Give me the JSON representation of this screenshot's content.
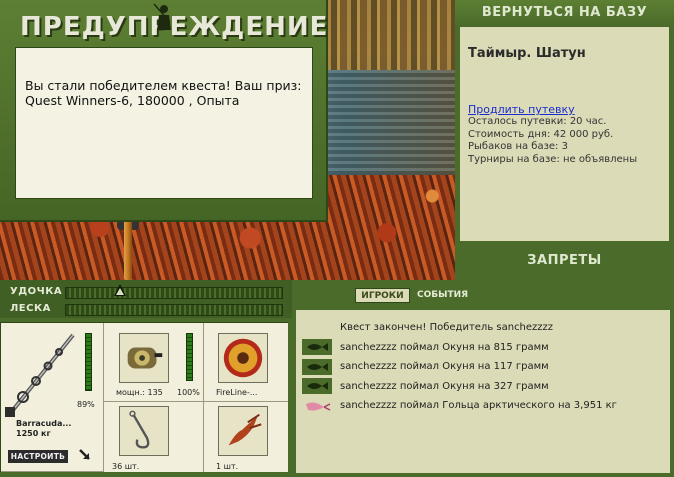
{
  "warning": {
    "title": "ПРЕДУПРЕЖДЕНИЕ",
    "message": "Вы стали победителем квеста! Ваш приз: Quest Winners-6, 180000 , Опыта"
  },
  "base": {
    "return_label": "ВЕРНУТЬСЯ НА БАЗУ",
    "name": "Таймыр. Шатун",
    "extend_label": "Продлить путевку",
    "lines": [
      "Осталось путевки: 20 час.",
      "Стоимость дня: 42 000 руб.",
      "Рыбаков на базе: 3",
      "Турниры на базе: не объявлены"
    ],
    "bans_label": "ЗАПРЕТЫ"
  },
  "tackle": {
    "rod_label": "УДОЧКА",
    "line_label": "ЛЕСКА",
    "rod_tension": 0.25
  },
  "equipment": {
    "rod": {
      "name": "Barracuda...",
      "weight": "1250 кг",
      "condition": "89%",
      "condition_value": 0.89
    },
    "reel": {
      "power": "мощн.: 135",
      "condition": "100%",
      "condition_value": 1.0
    },
    "line": {
      "name": "FireLine-..."
    },
    "hook": {
      "count": "36 шт."
    },
    "bait": {
      "count": "1 шт."
    },
    "tune_label": "НАСТРОИТЬ"
  },
  "events": {
    "tabs": [
      "ИГРОКИ",
      "СОБЫТИЯ"
    ],
    "items": [
      {
        "icon": "none",
        "text": "Квест закончен! Победитель sanchezzzz"
      },
      {
        "icon": "fish-icon",
        "text": "sanchezzzz поймал Окуня на 815 грамм"
      },
      {
        "icon": "fish-icon",
        "text": "sanchezzzz поймал Окуня на 117 грамм"
      },
      {
        "icon": "fish-icon",
        "text": "sanchezzzz поймал Окуня на 327 грамм"
      },
      {
        "icon": "lure-icon",
        "text": "sanchezzzz поймал Гольца арктического на 3,951 кг"
      }
    ]
  },
  "colors": {
    "panel_green": "#4a6b2a",
    "card_beige": "#dcdbb7",
    "link_blue": "#1a2ccc"
  }
}
